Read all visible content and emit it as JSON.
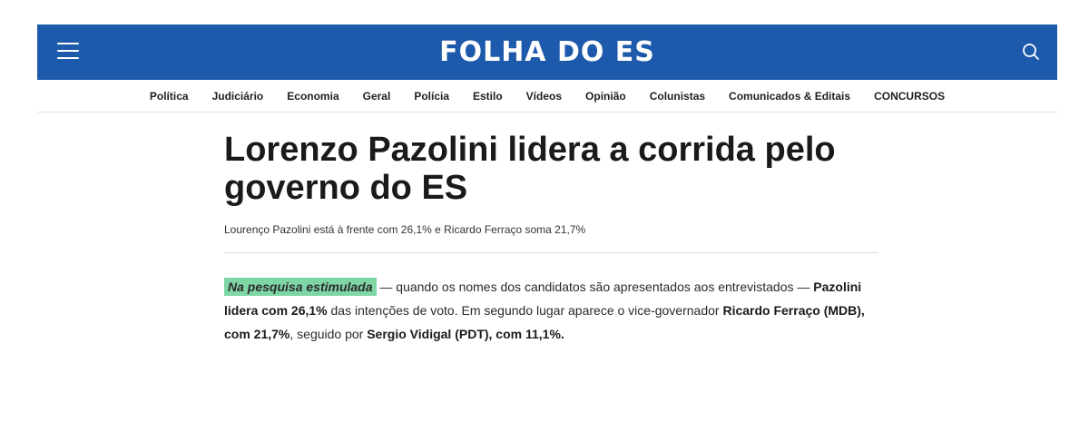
{
  "header": {
    "logo_text": "FOLHA DO ES",
    "menu_icon": "hamburger-menu-icon",
    "search_icon": "search-icon",
    "background_color": "#1d5aab"
  },
  "nav": {
    "items": [
      "Política",
      "Judiciário",
      "Economia",
      "Geral",
      "Polícia",
      "Estilo",
      "Vídeos",
      "Opinião",
      "Colunistas",
      "Comunicados & Editais",
      "CONCURSOS"
    ]
  },
  "article": {
    "headline": "Lorenzo Pazolini lidera a corrida pelo governo do ES",
    "subtitle": "Lourenço Pazolini está à frente com 26,1% e Ricardo Ferraço soma 21,7%",
    "body": {
      "highlight": "Na pesquisa estimulada",
      "part1": " — quando os nomes dos candidatos são apresentados aos entrevistados — ",
      "bold1": "Pazolini lidera com 26,1%",
      "part2": " das intenções de voto. Em segundo lugar aparece o vice-governador ",
      "bold2": "Ricardo Ferraço (MDB), com 21,7%",
      "part3": ", seguido por ",
      "bold3": "Sergio Vidigal (PDT), com 11,1%."
    },
    "highlight_color": "#7fd6a5"
  }
}
